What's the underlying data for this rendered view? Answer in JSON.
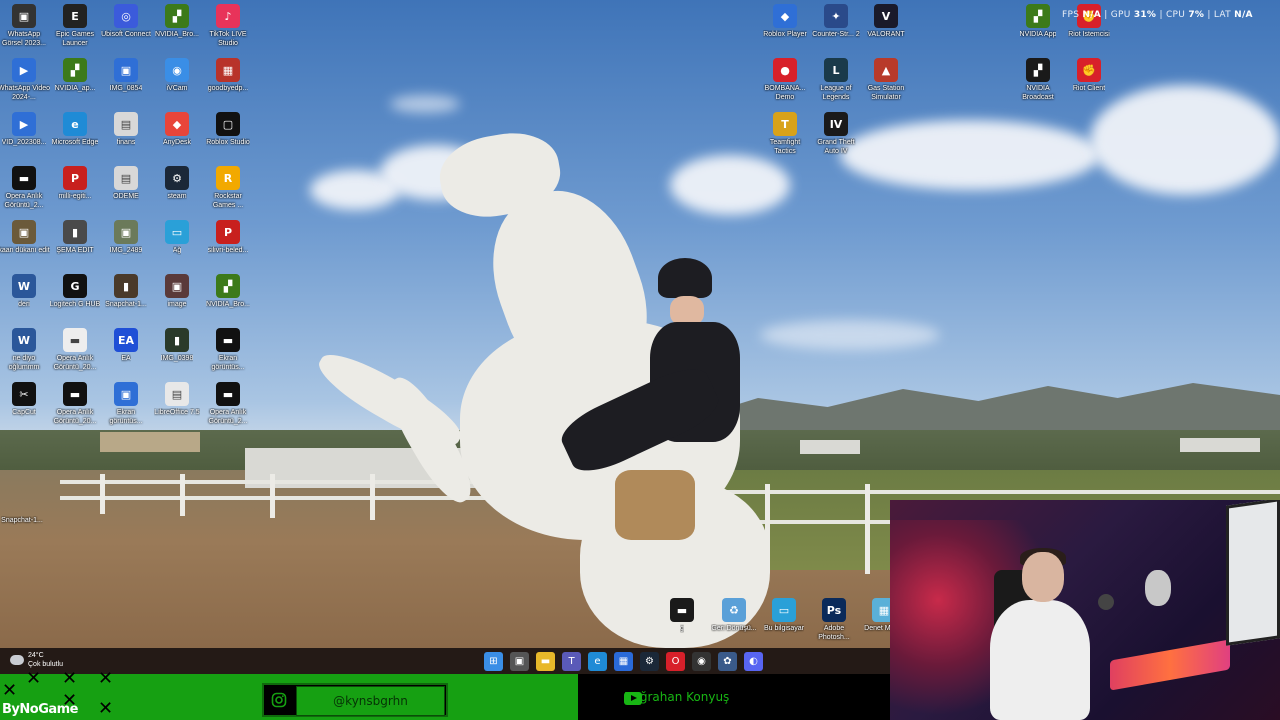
{
  "desktop": {
    "icons_left": [
      {
        "label": "WhatsApp Görsel 2023...",
        "color": "#333333",
        "glyph": "▣",
        "icon": "image-icon"
      },
      {
        "label": "Epic Games Launcer",
        "color": "#222222",
        "glyph": "E",
        "icon": "epic-games-icon"
      },
      {
        "label": "Ubisoft Connect",
        "color": "#3b5bdb",
        "glyph": "◎",
        "icon": "ubisoft-icon"
      },
      {
        "label": "NVIDIA_Bro...",
        "color": "#3c7a1a",
        "glyph": "▞",
        "icon": "nvidia-icon"
      },
      {
        "label": "TikTok LIVE Studio",
        "color": "#e8335a",
        "glyph": "♪",
        "icon": "tiktok-icon"
      },
      {
        "label": "WhatsApp Video 2024-...",
        "color": "#2f6fd6",
        "glyph": "▶",
        "icon": "video-file-icon"
      },
      {
        "label": "NVIDIA_ap...",
        "color": "#3c7a1a",
        "glyph": "▞",
        "icon": "nvidia-icon"
      },
      {
        "label": "IMG_0854",
        "color": "#2f6fd6",
        "glyph": "▣",
        "icon": "image-file-icon"
      },
      {
        "label": "iVCam",
        "color": "#3a8ee6",
        "glyph": "◉",
        "icon": "ivcam-icon"
      },
      {
        "label": "goodbyedp...",
        "color": "#b8332a",
        "glyph": "▦",
        "icon": "archive-icon"
      },
      {
        "label": "VID_202308...",
        "color": "#2f6fd6",
        "glyph": "▶",
        "icon": "video-file-icon"
      },
      {
        "label": "Microsoft Edge",
        "color": "#1f8bd6",
        "glyph": "e",
        "icon": "edge-icon"
      },
      {
        "label": "finans",
        "color": "#d8d8d8",
        "glyph": "▤",
        "icon": "document-icon"
      },
      {
        "label": "AnyDesk",
        "color": "#e8453a",
        "glyph": "◆",
        "icon": "anydesk-icon"
      },
      {
        "label": "Roblox Studio",
        "color": "#111111",
        "glyph": "▢",
        "icon": "roblox-studio-icon"
      },
      {
        "label": "Opera Anlık Görüntü_2...",
        "color": "#111111",
        "glyph": "▬",
        "icon": "screenshot-icon"
      },
      {
        "label": "milli-egiti...",
        "color": "#c8201e",
        "glyph": "P",
        "icon": "pdf-icon"
      },
      {
        "label": "ÖDEME",
        "color": "#d8d8d8",
        "glyph": "▤",
        "icon": "document-icon"
      },
      {
        "label": "steam",
        "color": "#1b2838",
        "glyph": "⚙",
        "icon": "steam-icon"
      },
      {
        "label": "Rockstar Games ...",
        "color": "#f2a900",
        "glyph": "R",
        "icon": "rockstar-icon"
      },
      {
        "label": "kaan dükanı edit",
        "color": "#6b5a3a",
        "glyph": "▣",
        "icon": "image-icon"
      },
      {
        "label": "ŞEMA EDIT",
        "color": "#4a4a4a",
        "glyph": "▮",
        "icon": "image-icon"
      },
      {
        "label": "IMG_2489",
        "color": "#6b7a5a",
        "glyph": "▣",
        "icon": "image-file-icon"
      },
      {
        "label": "Ağ",
        "color": "#2aa0d8",
        "glyph": "▭",
        "icon": "network-icon"
      },
      {
        "label": "silivri-beled...",
        "color": "#c8201e",
        "glyph": "P",
        "icon": "pdf-icon"
      },
      {
        "label": "deri",
        "color": "#2b579a",
        "glyph": "W",
        "icon": "word-icon"
      },
      {
        "label": "Logitech G HUB",
        "color": "#111111",
        "glyph": "G",
        "icon": "logitech-icon"
      },
      {
        "label": "Snapchat-1...",
        "color": "#4a3a2a",
        "glyph": "▮",
        "icon": "image-icon"
      },
      {
        "label": "image",
        "color": "#5a3a3a",
        "glyph": "▣",
        "icon": "image-icon"
      },
      {
        "label": "NVIDIA_Bro...",
        "color": "#3c7a1a",
        "glyph": "▞",
        "icon": "nvidia-icon"
      },
      {
        "label": "ne diyo oğlummm",
        "color": "#2b579a",
        "glyph": "W",
        "icon": "word-icon"
      },
      {
        "label": "Opera Anlık Görüntü_20...",
        "color": "#eeeeee",
        "glyph": "▬",
        "icon": "screenshot-icon"
      },
      {
        "label": "EA",
        "color": "#1f4fd6",
        "glyph": "EA",
        "icon": "ea-icon"
      },
      {
        "label": "IMG_0398",
        "color": "#2a3a2a",
        "glyph": "▮",
        "icon": "image-file-icon"
      },
      {
        "label": "Ekran görüntüs...",
        "color": "#111111",
        "glyph": "▬",
        "icon": "screenshot-icon"
      },
      {
        "label": "CapCut",
        "color": "#111111",
        "glyph": "✂",
        "icon": "capcut-icon"
      },
      {
        "label": "Opera Anlık Görüntü_20...",
        "color": "#111111",
        "glyph": "▬",
        "icon": "screenshot-icon"
      },
      {
        "label": "Ekran görüntüs...",
        "color": "#2f6fd6",
        "glyph": "▣",
        "icon": "image-file-icon"
      },
      {
        "label": "LibreOffice 7.5",
        "color": "#e8e8e8",
        "glyph": "▤",
        "icon": "libreoffice-icon"
      },
      {
        "label": "Opera Anlık Görüntü_2...",
        "color": "#111111",
        "glyph": "▬",
        "icon": "screenshot-icon"
      }
    ],
    "icons_right": [
      {
        "label": "Roblox Player",
        "color": "#2f6fd6",
        "glyph": "◆",
        "icon": "roblox-icon"
      },
      {
        "label": "Counter-Str... 2",
        "color": "#2a4a8a",
        "glyph": "✦",
        "icon": "counter-strike-icon"
      },
      {
        "label": "VALORANT",
        "color": "#1a1a2a",
        "glyph": "V",
        "icon": "valorant-icon"
      },
      {
        "label": "NVIDIA App",
        "color": "#3c7a1a",
        "glyph": "▞",
        "icon": "nvidia-icon"
      },
      {
        "label": "Riot İstemcisi",
        "color": "#d8202a",
        "glyph": "✊",
        "icon": "riot-icon"
      },
      {
        "label": "BOMBANA... Demo",
        "color": "#d8202a",
        "glyph": "●",
        "icon": "game-icon"
      },
      {
        "label": "League of Legends",
        "color": "#1a3a4a",
        "glyph": "L",
        "icon": "league-icon"
      },
      {
        "label": "Gas Station Simulator",
        "color": "#b83a2a",
        "glyph": "▲",
        "icon": "game-icon"
      },
      {
        "label": "NVIDIA Broadcast",
        "color": "#1a1a1a",
        "glyph": "▞",
        "icon": "nvidia-broadcast-icon"
      },
      {
        "label": "Riot Client",
        "color": "#d8202a",
        "glyph": "✊",
        "icon": "riot-icon"
      },
      {
        "label": "Teamfight Tactics",
        "color": "#d8a21a",
        "glyph": "T",
        "icon": "tft-icon"
      },
      {
        "label": "Grand Theft Auto IV",
        "color": "#1a1a1a",
        "glyph": "IV",
        "icon": "gta-icon"
      }
    ],
    "icons_bottom": [
      {
        "label": "Snapchat-1...",
        "color": "#4a3a2a",
        "glyph": "▮",
        "icon": "image-icon"
      },
      {
        "label": "g",
        "color": "#1a1a1a",
        "glyph": "▬",
        "icon": "screenshot-icon"
      },
      {
        "label": "Geri Dönüşü...",
        "color": "#5aa0d8",
        "glyph": "♻",
        "icon": "recycle-bin-icon"
      },
      {
        "label": "Bu bilgisayar",
        "color": "#2aa0d8",
        "glyph": "▭",
        "icon": "this-pc-icon"
      },
      {
        "label": "Adobe Photosh...",
        "color": "#0a2a5a",
        "glyph": "Ps",
        "icon": "photoshop-icon"
      },
      {
        "label": "Denet Mas...",
        "color": "#5ab0d8",
        "glyph": "▦",
        "icon": "control-panel-icon"
      }
    ]
  },
  "perf_overlay": {
    "fps_label": "FPS",
    "fps_value": "N/A",
    "gpu_label": "GPU",
    "gpu_value": "31%",
    "cpu_label": "CPU",
    "cpu_value": "7%",
    "lat_label": "LAT",
    "lat_value": "N/A"
  },
  "taskbar": {
    "weather_temp": "24°C",
    "weather_desc": "Çok bulutlu",
    "apps": [
      {
        "name": "start-button",
        "glyph": "⊞",
        "color": "#3a8ee6",
        "interactable": true
      },
      {
        "name": "task-view-icon",
        "glyph": "▣",
        "color": "#555555",
        "interactable": true
      },
      {
        "name": "file-explorer-icon",
        "glyph": "▬",
        "color": "#e8b82a",
        "interactable": true
      },
      {
        "name": "teams-icon",
        "glyph": "T",
        "color": "#5a5ab8",
        "interactable": true
      },
      {
        "name": "edge-icon",
        "glyph": "e",
        "color": "#1f8bd6",
        "interactable": true
      },
      {
        "name": "store-icon",
        "glyph": "▦",
        "color": "#2a6ad8",
        "interactable": true
      },
      {
        "name": "steam-icon",
        "glyph": "⚙",
        "color": "#1b2838",
        "interactable": true
      },
      {
        "name": "opera-icon",
        "glyph": "O",
        "color": "#d8202a",
        "interactable": true
      },
      {
        "name": "obs-icon",
        "glyph": "◉",
        "color": "#333333",
        "interactable": true
      },
      {
        "name": "settings-icon",
        "glyph": "✿",
        "color": "#3a5a8a",
        "interactable": true
      },
      {
        "name": "discord-icon",
        "glyph": "◐",
        "color": "#5865f2",
        "interactable": true
      }
    ]
  },
  "stream_overlay": {
    "brand": "ByNoGame",
    "instagram_handle": "@kynsbgrhn",
    "youtube_name": "Buğrahan Konyuş",
    "accent_green": "#16a012"
  }
}
